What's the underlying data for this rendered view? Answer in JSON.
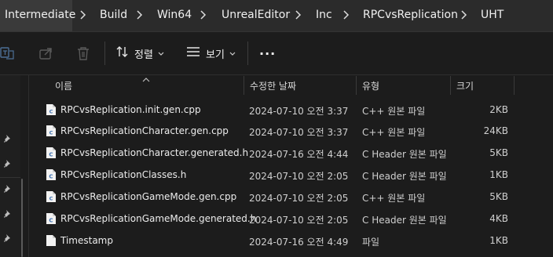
{
  "breadcrumb": {
    "items": [
      "Intermediate",
      "Build",
      "Win64",
      "UnrealEditor",
      "Inc",
      "RPCvsReplication",
      "UHT"
    ]
  },
  "toolbar": {
    "sort_label": "정렬",
    "view_label": "보기",
    "more_label": "···",
    "icons": [
      "translate-icon",
      "share-icon",
      "trash-icon",
      "sort-icon",
      "view-icon",
      "more-icon"
    ]
  },
  "columns": {
    "name": "이름",
    "modified": "수정한 날짜",
    "type": "유형",
    "size": "크기"
  },
  "files": [
    {
      "name": "RPCvsReplication.init.gen.cpp",
      "modified": "2024-07-10 오전 3:37",
      "type": "C++ 원본 파일",
      "size": "2KB",
      "icon": "cpp-file-icon"
    },
    {
      "name": "RPCvsReplicationCharacter.gen.cpp",
      "modified": "2024-07-10 오전 3:37",
      "type": "C++ 원본 파일",
      "size": "24KB",
      "icon": "cpp-file-icon"
    },
    {
      "name": "RPCvsReplicationCharacter.generated.h",
      "modified": "2024-07-16 오전 4:44",
      "type": "C Header 원본 파일",
      "size": "5KB",
      "icon": "header-file-icon"
    },
    {
      "name": "RPCvsReplicationClasses.h",
      "modified": "2024-07-10 오전 2:05",
      "type": "C Header 원본 파일",
      "size": "1KB",
      "icon": "header-file-icon"
    },
    {
      "name": "RPCvsReplicationGameMode.gen.cpp",
      "modified": "2024-07-10 오전 2:05",
      "type": "C++ 원본 파일",
      "size": "5KB",
      "icon": "cpp-file-icon"
    },
    {
      "name": "RPCvsReplicationGameMode.generated.h",
      "modified": "2024-07-10 오전 2:05",
      "type": "C Header 원본 파일",
      "size": "4KB",
      "icon": "header-file-icon"
    },
    {
      "name": "Timestamp",
      "modified": "2024-07-16 오전 4:49",
      "type": "파일",
      "size": "1KB",
      "icon": "blank-file-icon"
    }
  ],
  "colors": {
    "background": "#1c1c1c",
    "crumbbar": "#2b2b2b",
    "accent_file_icon": "#4a8fd6"
  }
}
